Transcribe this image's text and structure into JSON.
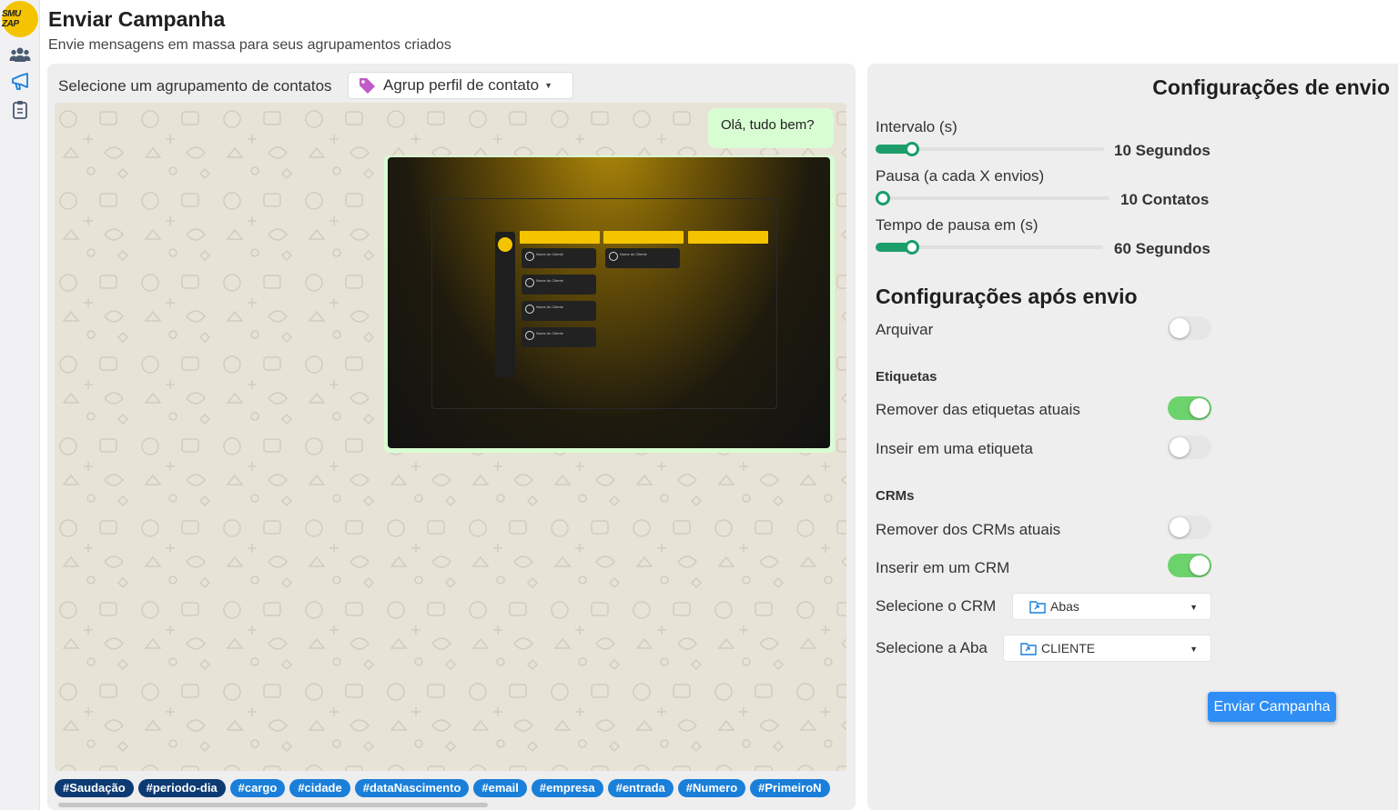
{
  "app": {
    "logo_text": "SMU ZAP"
  },
  "header": {
    "title": "Enviar Campanha",
    "subtitle": "Envie mensagens em massa para seus agrupamentos criados"
  },
  "sidebar": {
    "items": [
      {
        "icon": "users-icon"
      },
      {
        "icon": "megaphone-icon"
      },
      {
        "icon": "clipboard-icon"
      }
    ]
  },
  "left": {
    "group_label": "Selecione um agrupamento de contatos",
    "group_select_value": "Agrup perfil de contato",
    "message_text": "Olá, tudo bem?",
    "preview": {
      "card_text": "Nome do Cliente"
    },
    "tags": [
      "#Saudação",
      "#periodo-dia",
      "#cargo",
      "#cidade",
      "#dataNascimento",
      "#email",
      "#empresa",
      "#entrada",
      "#Numero",
      "#PrimeiroN"
    ]
  },
  "right": {
    "title": "Configurações de envio",
    "sliders": [
      {
        "label": "Intervalo (s)",
        "value_text": "10 Segundos",
        "fill": 0.16
      },
      {
        "label": "Pausa (a cada X envios)",
        "value_text": "10 Contatos",
        "fill": 0.03
      },
      {
        "label": "Tempo de pausa em (s)",
        "value_text": "60 Segundos",
        "fill": 0.16
      }
    ],
    "after_title": "Configurações após envio",
    "arquivar_label": "Arquivar",
    "arquivar_on": false,
    "etiquetas_head": "Etiquetas",
    "remover_etiquetas_label": "Remover das etiquetas atuais",
    "remover_etiquetas_on": true,
    "inserir_etiqueta_label": "Inseir em uma etiqueta",
    "inserir_etiqueta_on": false,
    "crms_head": "CRMs",
    "remover_crms_label": "Remover dos CRMs atuais",
    "remover_crms_on": false,
    "inserir_crm_label": "Inserir em um CRM",
    "inserir_crm_on": true,
    "select_crm_label": "Selecione o CRM",
    "select_crm_value": "Abas",
    "select_aba_label": "Selecione a Aba",
    "select_aba_value": "CLIENTE",
    "send_button": "Enviar Campanha"
  },
  "colors": {
    "accent_green": "#1b9e6a",
    "toggle_on": "#6cd36c",
    "tag_blue": "#1a7fd9",
    "tag_dark": "#0d3a72",
    "button_blue": "#2e8ef5",
    "logo_yellow": "#f5c400",
    "bubble_green": "#d9fdd3"
  }
}
